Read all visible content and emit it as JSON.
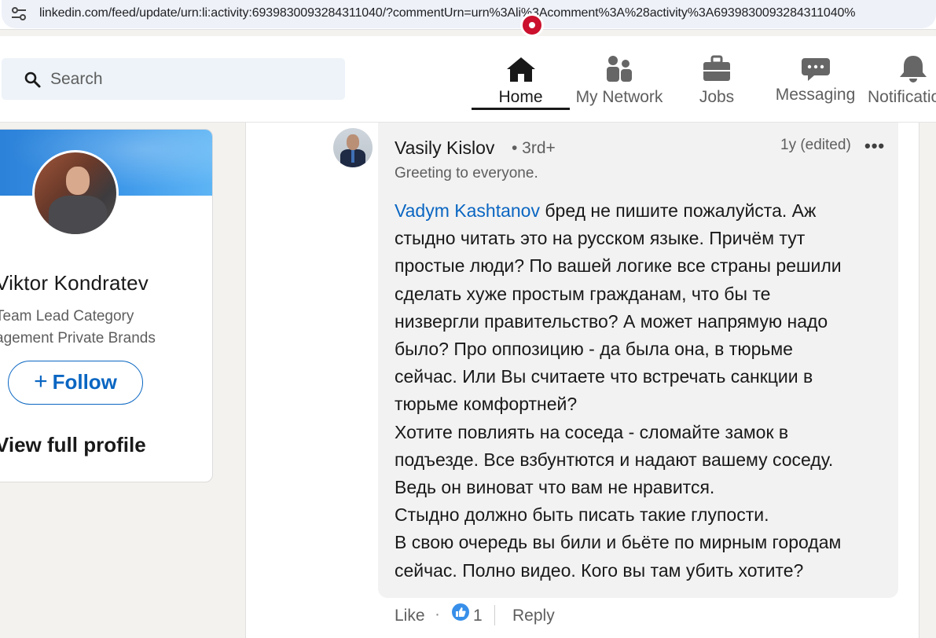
{
  "browser": {
    "url": "linkedin.com/feed/update/urn:li:activity:6939830093284311040/?commentUrn=urn%3Ali%3Acomment%3A%28activity%3A6939830093284311040%"
  },
  "nav": {
    "search_placeholder": "Search",
    "items": [
      {
        "label": "Home",
        "icon": "home-icon",
        "active": true
      },
      {
        "label": "My Network",
        "icon": "people-icon"
      },
      {
        "label": "Jobs",
        "icon": "briefcase-icon"
      },
      {
        "label": "Messaging",
        "icon": "chat-icon"
      },
      {
        "label": "Notificatio",
        "icon": "bell-icon"
      }
    ],
    "badge_color": "#cb112d"
  },
  "profile": {
    "name": "Viktor Kondratev",
    "headline_lines": [
      "Team Lead Category",
      "agement Private Brands"
    ],
    "follow_label": "Follow",
    "view_profile_label": "View full profile"
  },
  "comment": {
    "author": "Vasily Kislov",
    "degree": "• 3rd+",
    "tagline": "Greeting to everyone.",
    "time": "1y (edited)",
    "mention": "Vadym Kashtanov",
    "lines": [
      " бред не пишите пожалуйста. Аж",
      "стыдно читать это на русском языке. Причём тут",
      "простые люди? По вашей логике все страны решили",
      "сделать хуже простым гражданам, что бы те",
      "низвергли правительство? А может напрямую надо",
      "было? Про оппозицию - да была она, в тюрьме",
      "сейчас. Или Вы считаете что встречать санкции в",
      "тюрьме комфортней?",
      "Хотите повлиять на соседа - сломайте замок в",
      "подъезде. Все взбунтются и надают вашему соседу.",
      "Ведь он виноват что вам не нравится.",
      "Стыдно должно быть писать такие глупости.",
      "В свою очередь вы били и бьёте по мирным городам",
      "сейчас. Полно видео. Кого вы там убить хотите?"
    ],
    "like_label": "Like",
    "separator": "·",
    "reaction_count": "1",
    "reply_label": "Reply",
    "mention_color": "#0a66c2"
  }
}
